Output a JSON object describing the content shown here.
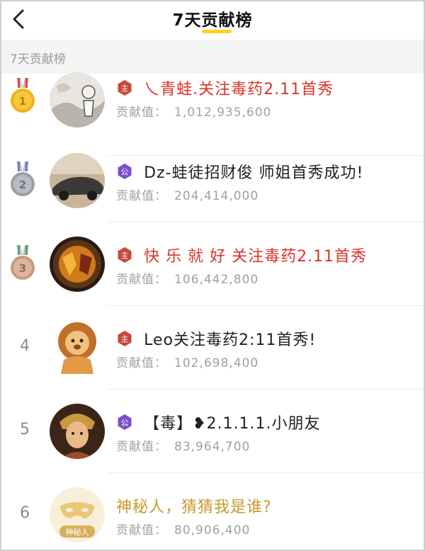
{
  "header": {
    "title": "7天贡献榜"
  },
  "section": {
    "label": "7天贡献榜"
  },
  "score_label": "贡献值：",
  "level_badges": {
    "red": "主",
    "purple": "公"
  },
  "mystery_badge_text": "神秘人",
  "colors": {
    "accent_yellow": "#ffd21e",
    "name_red": "#d9342b",
    "name_gold": "#c49a2c",
    "badge_red": "#c9483a",
    "badge_purple": "#7e4fc9"
  },
  "entries": [
    {
      "rank": "1",
      "medal": "gold-medal",
      "badge": "red",
      "name": "乀青蛙.关注毒药2.11首秀",
      "name_style": "red",
      "score": "1,012,935,600"
    },
    {
      "rank": "2",
      "medal": "silver-medal",
      "badge": "purple",
      "name": "Dz-蛙徒招财俊 师姐首秀成功!",
      "name_style": "dark",
      "score": "204,414,000"
    },
    {
      "rank": "3",
      "medal": "bronze-medal",
      "badge": "red",
      "name": "快 乐 就 好 关注毒药2.11首秀",
      "name_style": "red",
      "score": "106,442,800"
    },
    {
      "rank": "4",
      "medal": null,
      "badge": "red",
      "name": "Leo关注毒药2:11首秀!",
      "name_style": "dark",
      "score": "102,698,400"
    },
    {
      "rank": "5",
      "medal": null,
      "badge": "purple",
      "name": "【毒】❥2.1.1.1.小朋友",
      "name_style": "dark",
      "score": "83,964,700"
    },
    {
      "rank": "6",
      "medal": null,
      "badge": null,
      "name": "神秘人，猜猜我是谁?",
      "name_style": "gold",
      "score": "80,906,400"
    }
  ]
}
